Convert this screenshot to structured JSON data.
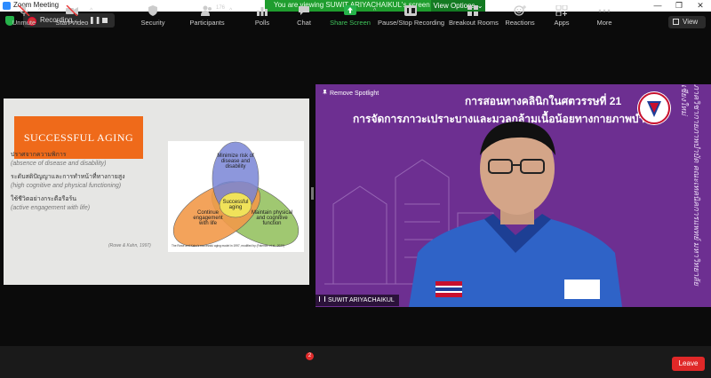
{
  "window": {
    "title": "Zoom Meeting",
    "controls": [
      "—",
      "❐",
      "✕"
    ]
  },
  "share_banner": {
    "text": "You are viewing SUWIT ARIYACHAIKUL's screen",
    "options_label": "View Options ⌄"
  },
  "recording": {
    "label": "Recording...",
    "pause_glyph": "❚❚"
  },
  "view_button": {
    "label": "View"
  },
  "slide": {
    "title": "SUCCESSFUL AGING",
    "lines": [
      {
        "thai": "ปราศจากความพิการ",
        "en": "(absence of disease and disability)"
      },
      {
        "thai": "ระดับสติปัญญาและการทำหน้าที่ทางกายสูง",
        "en": "(high cognitive and physical functioning)"
      },
      {
        "thai": "ใช้ชีวิตอย่างกระตือรือร้น",
        "en": "(active engagement with life)"
      }
    ],
    "citation": "(Rowe & Kahn, 1997)",
    "venn": {
      "top": "Minimize risk of disease and disability",
      "left": "Continue engagement with life",
      "right": "Maintain physical and cognitive function",
      "center": "Successful aging",
      "caption": "The Rowe and Kahn's successful aging model in 1997, modified by (Fatemeh et al., 2020)",
      "colors": {
        "top": "#7a86d6",
        "left": "#f29a4a",
        "right": "#9bc66a",
        "center": "#f0e25a"
      }
    }
  },
  "video": {
    "remove_spotlight": "Remove Spotlight",
    "heading_line1": "การสอนทางคลินิกในศตวรรษที่ 21",
    "heading_line2": "การจัดการภาวะเปราะบางและมวลกล้ามเนื้อน้อยทางกายภาพบำบัด",
    "vertical_text": "ภาควิชากายภาพบำบัด คณะเทคนิคการแพทย์ มหาวิทยาลัยเชียงใหม่",
    "participant_name": "SUWIT ARIYACHAIKUL",
    "bg_color": "#6d2f91"
  },
  "toolbar": {
    "unmute": "Unmute",
    "start_video": "Start Video",
    "security": "Security",
    "participants": "Participants",
    "participants_count": "176",
    "polls": "Polls",
    "chat": "Chat",
    "chat_badge": "2",
    "share_screen": "Share Screen",
    "record": "Pause/Stop Recording",
    "breakout": "Breakout Rooms",
    "reactions": "Reactions",
    "apps": "Apps",
    "more": "More",
    "leave": "Leave",
    "caret": "^"
  },
  "colors": {
    "accent_green": "#1f9d2e",
    "leave_red": "#e02828",
    "share_green": "#26b34a"
  }
}
